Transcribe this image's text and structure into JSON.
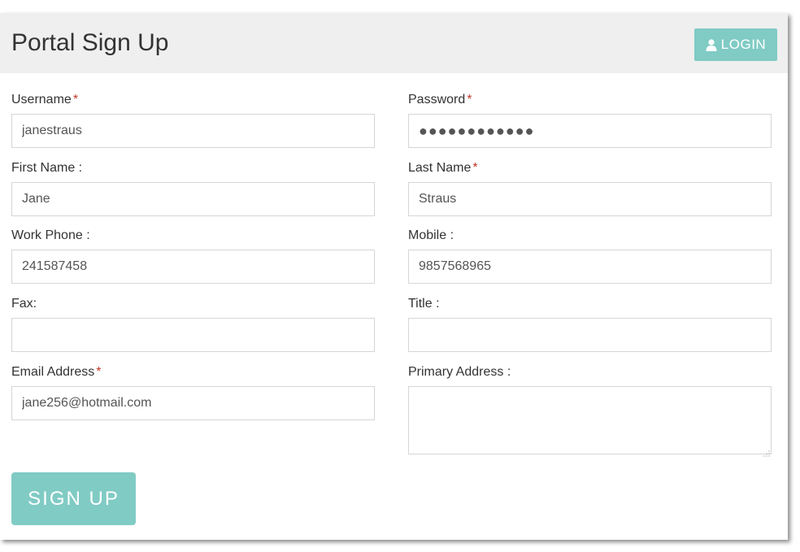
{
  "header": {
    "title": "Portal Sign Up",
    "login_label": "LOGIN",
    "login_icon": "user-icon"
  },
  "form": {
    "username": {
      "label": "Username",
      "required": "*",
      "value": "janestraus"
    },
    "password": {
      "label": "Password",
      "required": "*",
      "value": "●●●●●●●●●●●●"
    },
    "first_name": {
      "label": "First Name :",
      "value": "Jane"
    },
    "last_name": {
      "label": "Last Name",
      "required": "*",
      "value": "Straus"
    },
    "work_phone": {
      "label": "Work Phone :",
      "value": "241587458"
    },
    "mobile": {
      "label": "Mobile :",
      "value": "9857568965"
    },
    "fax": {
      "label": "Fax:",
      "value": ""
    },
    "title": {
      "label": "Title :",
      "value": ""
    },
    "email": {
      "label": "Email Address",
      "required": "*",
      "value": "jane256@hotmail.com"
    },
    "primary_address": {
      "label": "Primary Address :",
      "value": ""
    }
  },
  "actions": {
    "signup_label": "SIGN UP"
  },
  "colors": {
    "accent": "#80cbc4",
    "required": "#c0392b",
    "header_bg": "#efefef"
  }
}
